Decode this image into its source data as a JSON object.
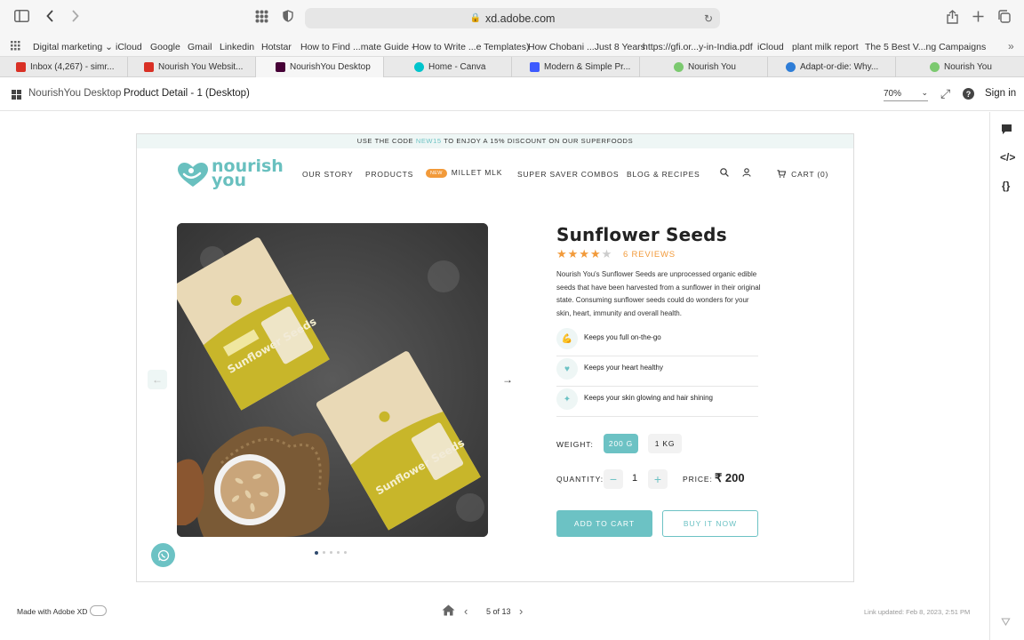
{
  "browser": {
    "url": "xd.adobe.com",
    "bookmarks": [
      "Digital marketing",
      "iCloud",
      "Google",
      "Gmail",
      "Linkedin",
      "Hotstar",
      "How to Find ...mate Guide -",
      "How to Write ...e Templates)",
      "How Chobani ...Just 8 Years",
      "https://gfi.or...y-in-India.pdf",
      "iCloud",
      "plant milk report",
      "The 5 Best V...ng Campaigns"
    ],
    "tabs": [
      {
        "label": "Inbox (4,267) - simr...",
        "color": "#d93025"
      },
      {
        "label": "Nourish You Websit...",
        "color": "#d93025"
      },
      {
        "label": "NourishYou Desktop",
        "color": "#470137"
      },
      {
        "label": "Home - Canva",
        "color": "#00c4cc"
      },
      {
        "label": "Modern & Simple Pr...",
        "color": "#3d5afe"
      },
      {
        "label": "Nourish You",
        "color": "#7bc96f"
      },
      {
        "label": "Adapt-or-die: Why...",
        "color": "#2e7dd7"
      },
      {
        "label": "Nourish You",
        "color": "#7bc96f"
      }
    ]
  },
  "xd": {
    "project": "NourishYou Desktop",
    "screen": "Product Detail - 1 (Desktop)",
    "zoom": "70%",
    "sign_in": "Sign in",
    "made_with": "Made with Adobe XD",
    "page_indicator": "5 of 13",
    "link_updated": "Link updated: Feb 8, 2023, 2:51 PM"
  },
  "site": {
    "promo_prefix": "USE THE CODE ",
    "promo_code": "NEW15",
    "promo_suffix": " TO ENJOY A 15% DISCOUNT ON OUR SUPERFOODS",
    "logo_line1": "nourish",
    "logo_line2": "you",
    "nav": [
      "OUR STORY",
      "PRODUCTS",
      "MILLET MLK",
      "SUPER SAVER COMBOS",
      "BLOG & RECIPES"
    ],
    "new_badge": "NEW",
    "cart": "CART (0)"
  },
  "product": {
    "title": "Sunflower Seeds",
    "rating": 4,
    "rating_max": 5,
    "reviews": "6 REVIEWS",
    "description": "Nourish You's Sunflower Seeds are unprocessed organic edible seeds that have been harvested from a sunflower in their original state. Consuming sunflower seeds could do wonders for your skin, heart, immunity and overall health.",
    "benefits": [
      "Keeps you full on-the-go",
      "Keeps your heart healthy",
      "Keeps your skin glowing and hair shining"
    ],
    "weight_label": "WEIGHT:",
    "weights": [
      "200 G",
      "1 KG"
    ],
    "quantity_label": "QUANTITY:",
    "quantity": "1",
    "price_label": "PRICE:",
    "price": "₹ 200",
    "add_to_cart": "ADD TO CART",
    "buy_now": "BUY IT NOW",
    "pack_label": "Sunflower Seeds",
    "carousel_count": 5,
    "carousel_active": 1
  },
  "colors": {
    "accent": "#6cc2c4",
    "orange": "#f29a3a"
  }
}
